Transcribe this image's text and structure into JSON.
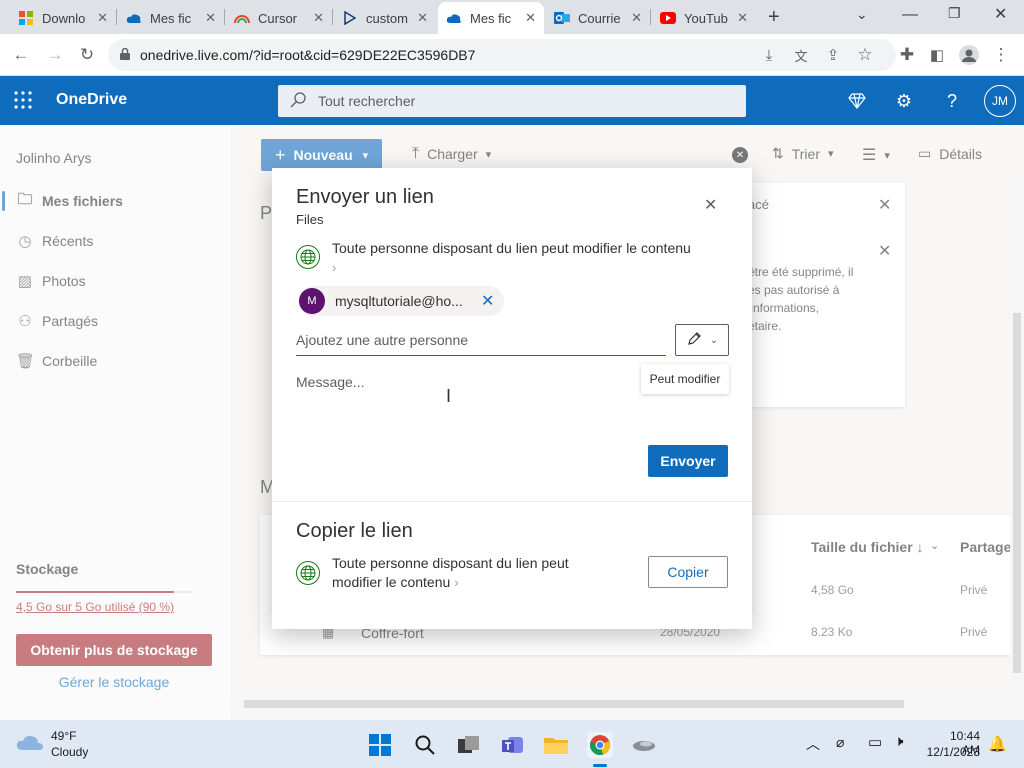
{
  "browser": {
    "tabs": [
      {
        "title": "Downlo",
        "icon": "windows-logo-icon"
      },
      {
        "title": "Mes fic",
        "icon": "onedrive-cloud-icon"
      },
      {
        "title": "Cursor",
        "icon": "rainbow-icon"
      },
      {
        "title": "custom",
        "icon": "play-arrow-icon"
      },
      {
        "title": "Mes fic",
        "icon": "onedrive-cloud-icon",
        "active": true
      },
      {
        "title": "Courrie",
        "icon": "outlook-icon"
      },
      {
        "title": "YouTub",
        "icon": "youtube-icon"
      }
    ],
    "url": "onedrive.live.com/?id=root&cid=629DE22EC3596DB7"
  },
  "header": {
    "brand": "OneDrive",
    "search_placeholder": "Tout rechercher",
    "avatar_initials": "JM",
    "color": "#0f6cbd"
  },
  "sidebar": {
    "user": "Jolinho Arys",
    "items": [
      {
        "label": "Mes fichiers",
        "icon": "folder-icon",
        "selected": true
      },
      {
        "label": "Récents",
        "icon": "clock-icon"
      },
      {
        "label": "Photos",
        "icon": "photo-icon"
      },
      {
        "label": "Partagés",
        "icon": "people-icon"
      },
      {
        "label": "Corbeille",
        "icon": "trash-icon"
      }
    ],
    "storage_title": "Stockage",
    "storage_usage": "4,5 Go sur 5 Go utilisé (90 %)",
    "storage_fraction": 0.9,
    "get_storage": "Obtenir plus de stockage",
    "manage_storage": "Gérer le stockage"
  },
  "commandbar": {
    "new": "Nouveau",
    "upload": "Charger",
    "sort": "Trier",
    "details": "Détails"
  },
  "background": {
    "heading_p": "P",
    "heading_m": "M",
    "banner_title_frag": "acé",
    "banner_lines": [
      "être été supprimé, il",
      "es pas autorisé à",
      "'informations,",
      "étaire."
    ],
    "columns": {
      "size": "Taille du fichier ↓",
      "share": "Partage"
    },
    "rows": [
      {
        "name": "",
        "date": "",
        "size": "4,58 Go",
        "share": "Privé"
      },
      {
        "name": "Coffre-fort",
        "date": "28/05/2020",
        "size": "8.23 Ko",
        "share": "Privé"
      }
    ]
  },
  "dialog": {
    "title": "Envoyer un lien",
    "subtitle": "Files",
    "permission_text": "Toute personne disposant du lien peut modifier le contenu",
    "chevron": "›",
    "recipient_initial": "M",
    "recipient": "mysqltutoriale@ho...",
    "add_placeholder": "Ajoutez une autre personne",
    "tooltip": "Peut modifier",
    "message_placeholder": "Message...",
    "send": "Envoyer",
    "copy_title": "Copier le lien",
    "copy_permission_line1": "Toute personne disposant du lien peut",
    "copy_permission_line2": "modifier le contenu",
    "copy": "Copier"
  },
  "taskbar": {
    "temp": "49°F",
    "weather": "Cloudy",
    "time": "10:44 AM",
    "date": "12/1/2023"
  }
}
